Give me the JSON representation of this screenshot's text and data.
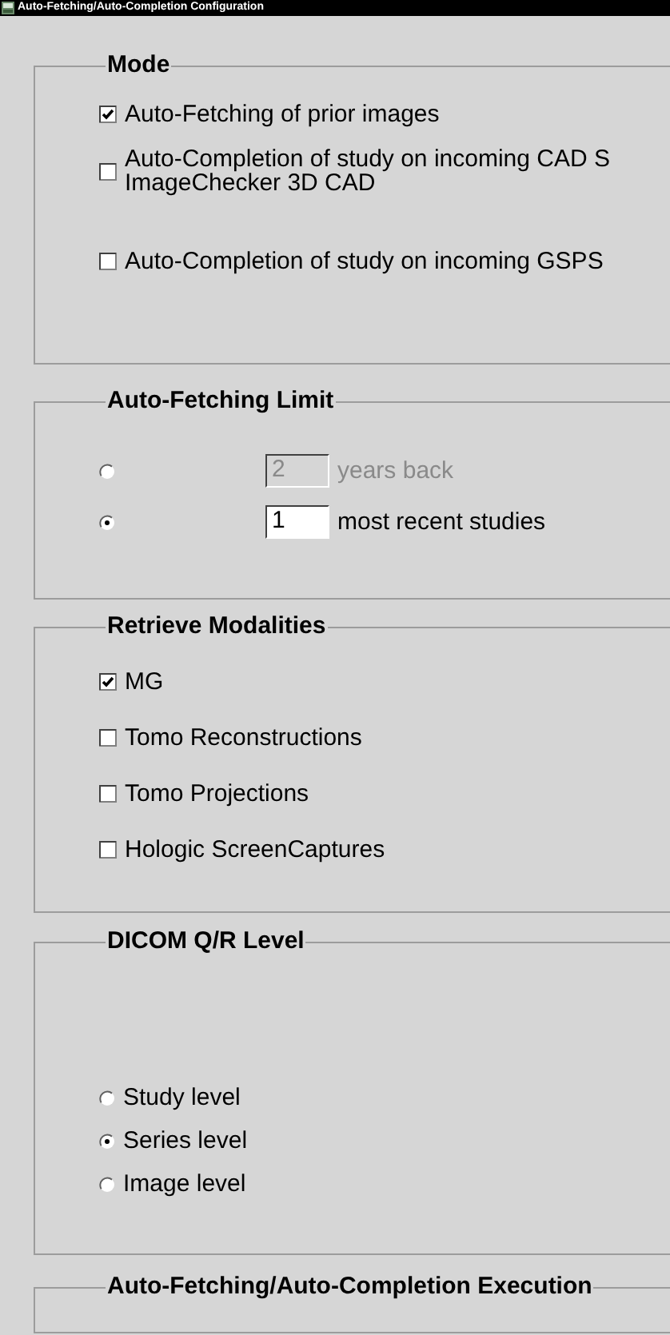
{
  "window": {
    "title": "Auto-Fetching/Auto-Completion Configuration"
  },
  "groups": [
    {
      "title": "Mode",
      "kind": "checks",
      "items": [
        {
          "label": "Auto-Fetching of prior images",
          "checked": true
        },
        {
          "label": "Auto-Completion of study on incoming CAD S",
          "second_line": "ImageChecker 3D CAD",
          "checked": false
        },
        {
          "label": "Auto-Completion of study on incoming GSPS",
          "checked": false
        }
      ]
    },
    {
      "title": "Auto-Fetching Limit",
      "kind": "limit",
      "items": [
        {
          "value": "2",
          "label": "years back",
          "selected": false,
          "disabled": true
        },
        {
          "value": "1",
          "label": "most recent studies",
          "selected": true,
          "disabled": false
        }
      ]
    },
    {
      "title": "Retrieve Modalities",
      "kind": "checks",
      "items": [
        {
          "label": "MG",
          "checked": true
        },
        {
          "label": "Tomo Reconstructions",
          "checked": false
        },
        {
          "label": "Tomo Projections",
          "checked": false
        },
        {
          "label": "Hologic ScreenCaptures",
          "checked": false
        }
      ]
    },
    {
      "title": "DICOM Q/R Level",
      "kind": "radios",
      "items": [
        {
          "label": "Study level",
          "selected": false
        },
        {
          "label": "Series level",
          "selected": true
        },
        {
          "label": "Image level",
          "selected": false
        }
      ]
    },
    {
      "title": "Auto-Fetching/Auto-Completion Execution"
    }
  ]
}
